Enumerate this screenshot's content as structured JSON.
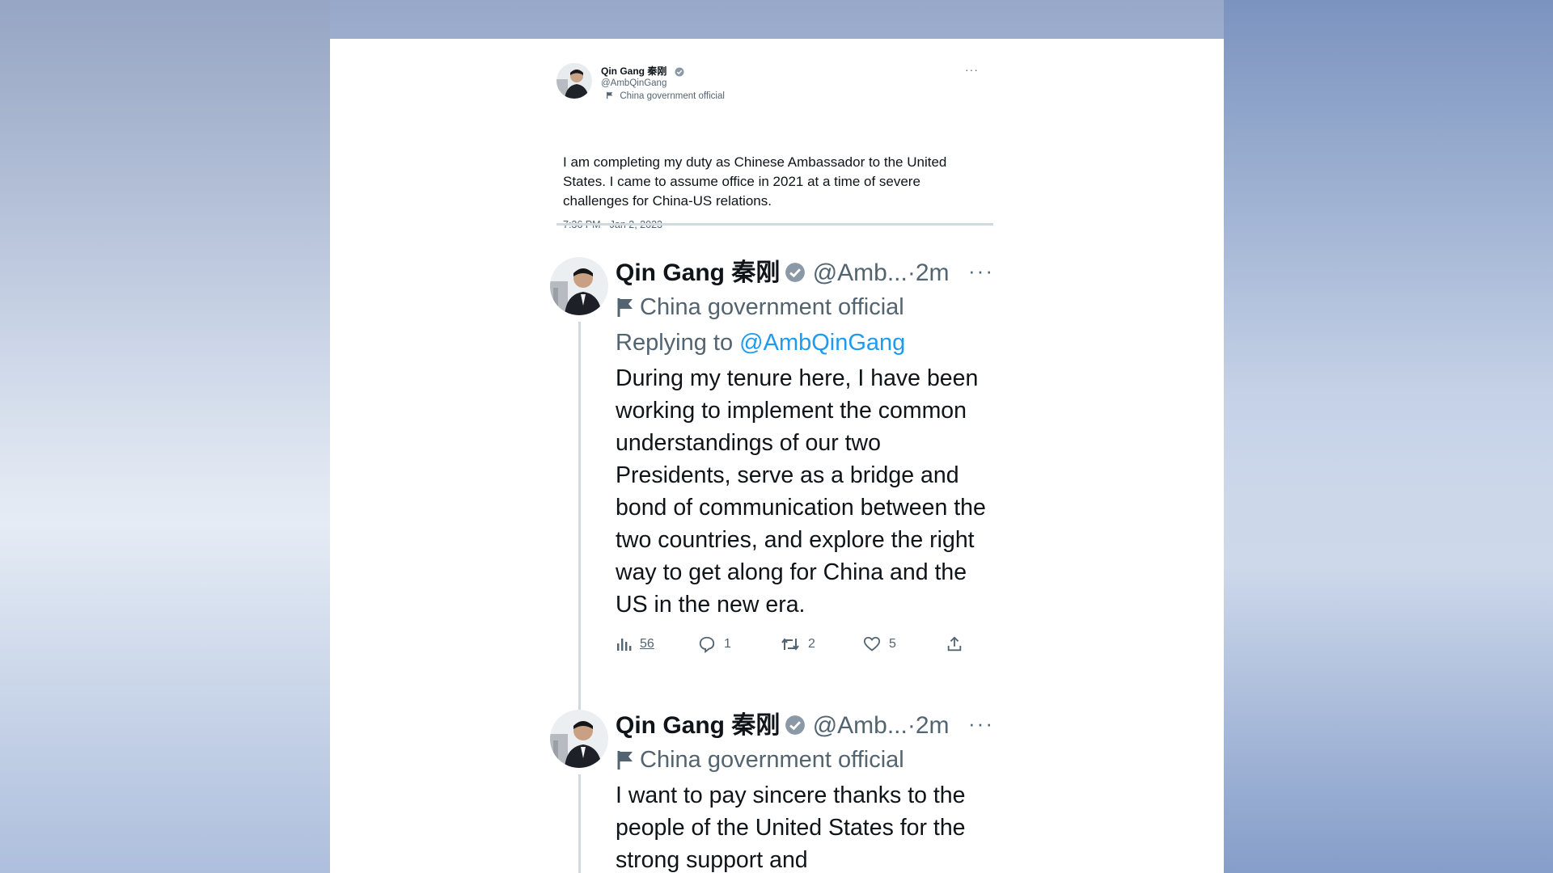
{
  "colors": {
    "link_blue": "#1d9bf0",
    "secondary_text": "#536471",
    "primary_text": "#0f1419",
    "verified_badge": "#8b98a5"
  },
  "quoted_tweet": {
    "name": "Qin Gang 秦刚",
    "handle": "@AmbQinGang",
    "label": "China government official",
    "text": "I am completing my duty as Chinese Ambassador to the United States. I came to assume office in 2021 at a time of severe challenges for China-US relations.",
    "timestamp": "7:36 PM · Jan 2, 2023",
    "more": "···"
  },
  "thread": [
    {
      "name": "Qin Gang 秦刚",
      "handle": "@Amb...",
      "separator": "·",
      "time": "2m",
      "more": "···",
      "label": "China government official",
      "replying_prefix": "Replying to",
      "replying_to": "@AmbQinGang",
      "text": "During my tenure here, I have been working to implement the common understandings of our two Presidents, serve as a bridge and bond of communication between the two countries, and explore the right way to get along for China and the US in the new era.",
      "stats": {
        "views": "56",
        "replies": "1",
        "retweets": "2",
        "likes": "5"
      },
      "icons": [
        "views-icon",
        "reply-icon",
        "retweet-icon",
        "like-icon",
        "share-icon"
      ]
    },
    {
      "name": "Qin Gang 秦刚",
      "handle": "@Amb...",
      "separator": "·",
      "time": "2m",
      "more": "···",
      "label": "China government official",
      "text": "I want to pay sincere thanks to the people of the United States for the strong support and"
    }
  ]
}
